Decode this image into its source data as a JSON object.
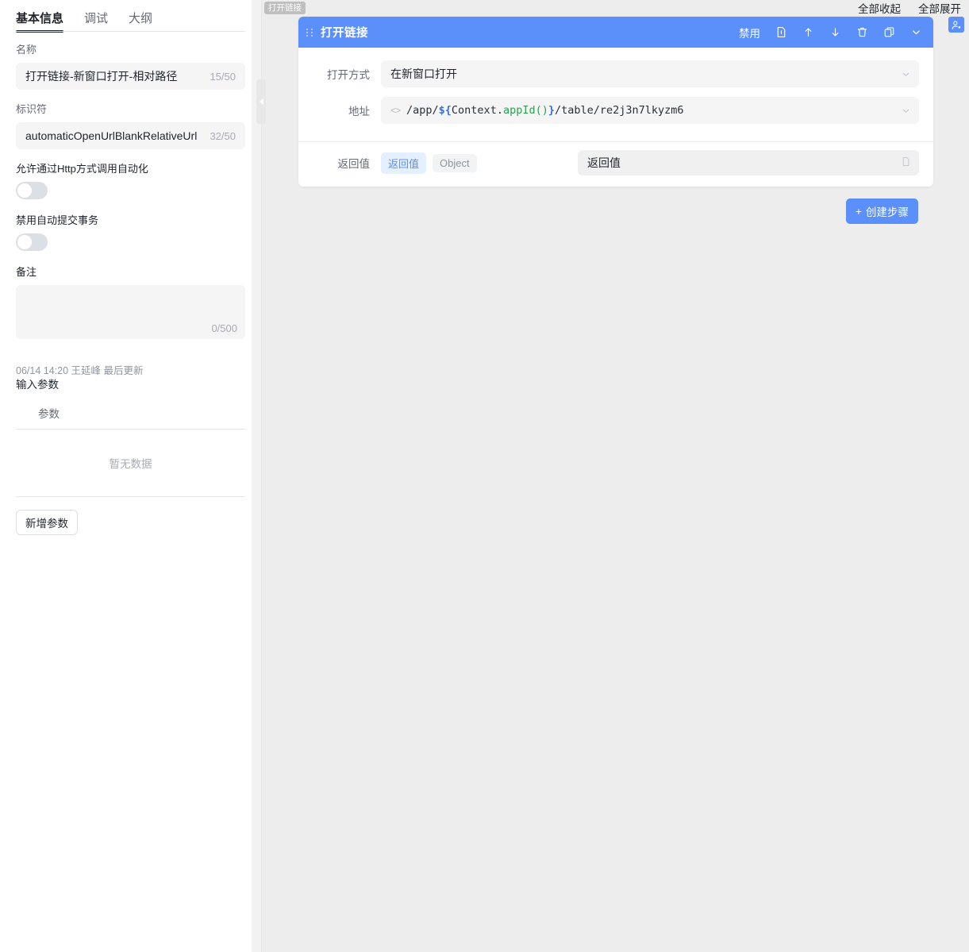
{
  "sidebar": {
    "tabs": [
      {
        "label": "基本信息",
        "active": true
      },
      {
        "label": "调试",
        "active": false
      },
      {
        "label": "大纲",
        "active": false
      }
    ],
    "name_field": {
      "label": "名称",
      "value": "打开链接-新窗口打开-相对路径",
      "counter": "15/50"
    },
    "identifier_field": {
      "label": "标识符",
      "value": "automaticOpenUrlBlankRelativeUrl",
      "counter": "32/50"
    },
    "http_toggle": {
      "label": "允许通过Http方式调用自动化",
      "value": "off"
    },
    "txn_toggle": {
      "label": "禁用自动提交事务",
      "value": "off"
    },
    "remark_field": {
      "label": "备注",
      "value": "",
      "counter": "0/500"
    },
    "meta": "06/14 14:20 王延峰 最后更新",
    "input_params": {
      "title": "输入参数",
      "column_header": "参数",
      "empty_text": "暂无数据",
      "add_button": "新增参数"
    },
    "collapse_handle": "collapse-sidebar"
  },
  "topbar": {
    "collapse_all": "全部收起",
    "expand_all": "全部展开"
  },
  "tooltip": {
    "text": "打开链接"
  },
  "card": {
    "title": "打开链接",
    "header_actions": {
      "disable_label": "禁用",
      "icons": [
        "document-icon",
        "move-up-icon",
        "move-down-icon",
        "trash-icon",
        "copy-icon",
        "chevron-down-icon"
      ]
    },
    "fields": [
      {
        "label": "打开方式",
        "value": "在新窗口打开",
        "type": "select"
      },
      {
        "label": "地址",
        "type": "code",
        "value": "/app/${Context.appId()}/table/re2j3n7lkyzm6",
        "code_parts": [
          {
            "text": "/app/",
            "style": "plain"
          },
          {
            "text": "${",
            "style": "brace"
          },
          {
            "text": "Context.",
            "style": "plain"
          },
          {
            "text": "appId()",
            "style": "fn"
          },
          {
            "text": "}",
            "style": "brace"
          },
          {
            "text": "/table/re2j3n7lkyzm6",
            "style": "plain"
          }
        ]
      }
    ],
    "return_row": {
      "label": "返回值",
      "pill_active": "返回值",
      "pill_muted": "Object",
      "input_value": "返回值"
    }
  },
  "add_step_button": {
    "plus": "+",
    "label": "创建步骤"
  },
  "colors": {
    "accent": "#5b8ff9",
    "canvas": "#ededed",
    "input_bg": "#f5f5f5",
    "tooltip_bg": "#bfbfbf",
    "code_fn": "#2e9e52",
    "code_brace": "#3b6fd4"
  }
}
